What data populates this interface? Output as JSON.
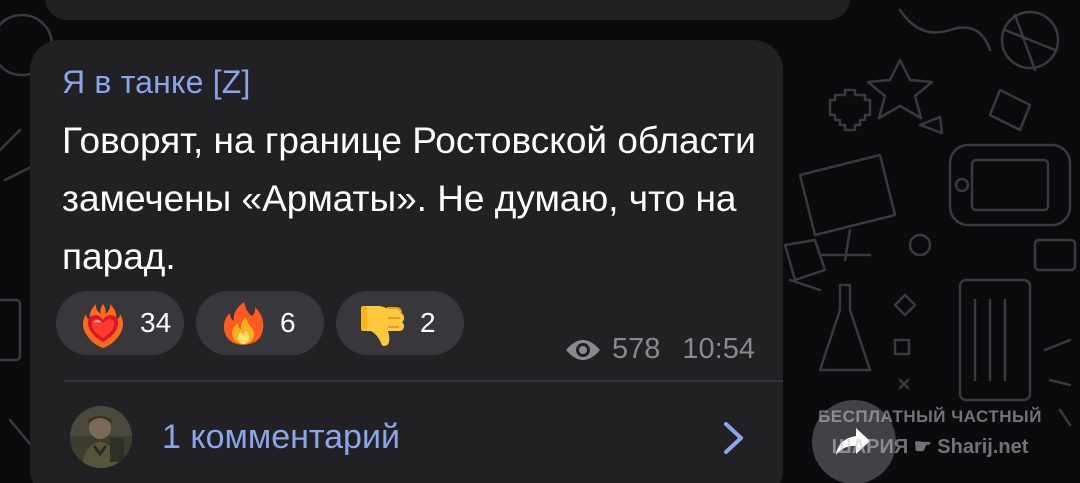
{
  "message": {
    "sender": "Я в танке [Z]",
    "text": "Говорят, на границе Ростовской области замечены «Арматы». Не думаю, что на парад.",
    "views": "578",
    "time": "10:54"
  },
  "reactions": [
    {
      "icon": "heart-on-fire-icon",
      "count": "34"
    },
    {
      "icon": "fire-icon",
      "count": "6"
    },
    {
      "icon": "thumbs-down-icon",
      "count": "2"
    }
  ],
  "comments": {
    "label": "1 комментарий"
  },
  "watermark": {
    "line1": "БЕСПЛАТНЫЙ ЧАСТНЫЙ",
    "line2_left": "ШАРИЯ",
    "line2_right": "Sharij.net"
  },
  "colors": {
    "background": "#0b0b0d",
    "bubble": "#212124",
    "accent": "#8aa6e8",
    "reaction_pill": "#38383c",
    "meta_text": "#8a8a8e"
  }
}
